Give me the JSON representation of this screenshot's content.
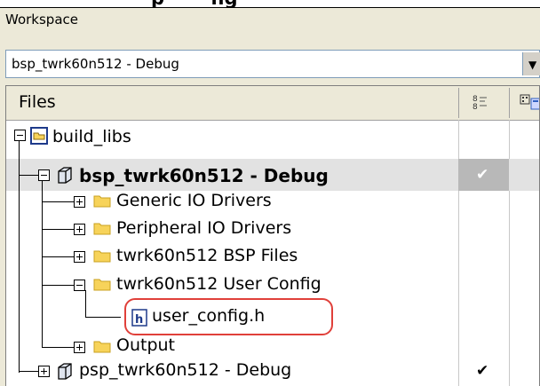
{
  "top_strip": {
    "clipped_text": "p_____ng"
  },
  "workspace": {
    "title": "Workspace",
    "config_selected": "bsp_twrk60n512 - Debug"
  },
  "tree": {
    "header_files": "Files",
    "header_col1_icon": "options-icon",
    "header_col2_icon": "grid-icon",
    "rows": [
      {
        "label": "build_libs",
        "icon": "workspace-icon",
        "check": ""
      },
      {
        "label": "bsp_twrk60n512 - Debug",
        "icon": "project-icon",
        "check": "✔"
      },
      {
        "label": "Generic IO Drivers",
        "icon": "folder-icon",
        "check": ""
      },
      {
        "label": "Peripheral IO Drivers",
        "icon": "folder-icon",
        "check": ""
      },
      {
        "label": "twrk60n512 BSP Files",
        "icon": "folder-icon",
        "check": ""
      },
      {
        "label": "twrk60n512 User Config",
        "icon": "folder-icon",
        "check": ""
      },
      {
        "label": "user_config.h",
        "icon": "header-file-icon",
        "check": ""
      },
      {
        "label": "Output",
        "icon": "folder-icon",
        "check": ""
      },
      {
        "label": "psp_twrk60n512 - Debug",
        "icon": "project-icon",
        "check": "✔"
      }
    ]
  },
  "colors": {
    "highlight_ring": "#e0403a",
    "folder": "#f7d35a",
    "selected_row": "#e2e2e2"
  }
}
